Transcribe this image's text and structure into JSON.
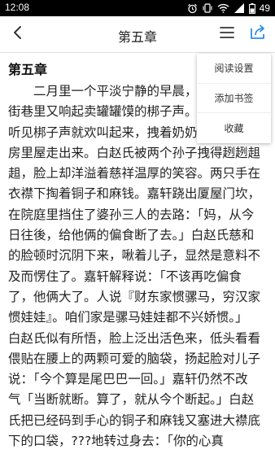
{
  "status": {
    "time": "12:08",
    "battery": "49"
  },
  "header": {
    "title": "第五章"
  },
  "content": {
    "chapter_title": "第五章",
    "lines": [
      "　　二月里一个平淡宁静的早晨，",
      "街巷里又响起卖罐罐馍的梆子声。",
      "听见梆子声就欢叫起来，拽着奶奶的衣襟从上",
      "房里屋走出来。白赵氏被两个孙子拽得趔趔趄",
      "趄，脸上却洋溢着慈祥温厚的笑容。两只手在",
      "衣襟下掏着铜子和麻钱。嘉轩跷出厦屋门坎，",
      "在院庭里挡住了婆孙三人的去路：「妈，从今",
      "日往後，给他俩的偏食断了去。」白赵氏慈和",
      "的脸顿时沉阴下来，啾着儿子，显然是意料不",
      "及而愣住了。嘉轩解释说：「不该再吃偏食",
      "了，他俩大了。人说『财东家惯骡马，穷汉家",
      "惯娃娃』。咱们家是骡马娃娃都不兴娇惯。」",
      "白赵氏似有所悟，脸上泛出活色来，低头看看",
      "偎贴在腰上的两颗可爱的脑袋，扬起脸对儿子",
      "说：「今个算是尾巴巴一回。」嘉轩仍然不改",
      "气「当断就断。算了，就从今个断起。」白赵",
      "氏把已经码到手心的铜子和麻钱又塞进大襟底",
      "下的口袋，???地转过身去：「你的心真"
    ]
  },
  "menu": {
    "items": [
      "阅读设置",
      "添加书签",
      "收藏"
    ]
  }
}
